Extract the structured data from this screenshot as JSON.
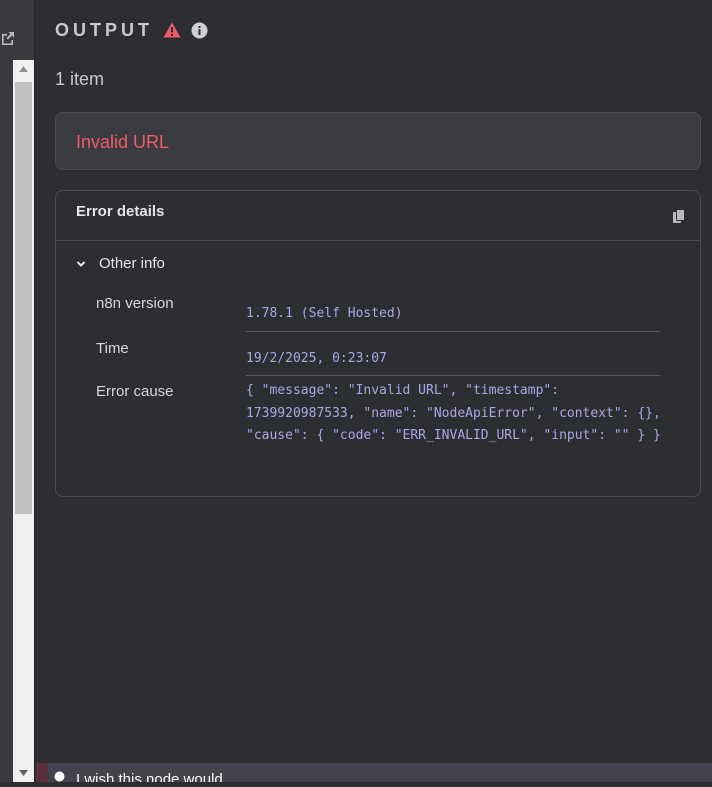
{
  "panel": {
    "title": "OUTPUT",
    "item_count": "1 item"
  },
  "error": {
    "message": "Invalid URL"
  },
  "details": {
    "title": "Error details",
    "section_label": "Other info",
    "rows": [
      {
        "key": "n8n version",
        "value": "1.78.1 (Self Hosted)"
      },
      {
        "key": "Time",
        "value": "19/2/2025, 0:23:07"
      },
      {
        "key": "Error cause",
        "value": "{ \"message\": \"Invalid URL\", \"timestamp\": 1739920987533, \"name\": \"NodeApiError\", \"context\": {}, \"cause\": { \"code\": \"ERR_INVALID_URL\", \"input\": \"\" } }"
      }
    ]
  },
  "feedback": {
    "text": "I wish this node would"
  },
  "icons": {
    "warning": "warning-triangle-icon",
    "info": "info-circle-icon",
    "copy": "copy-icon",
    "chevron": "chevron-down-icon",
    "external": "external-link-icon",
    "feedback": "bulb-icon"
  },
  "colors": {
    "background": "#2d2e32",
    "error": "#ef5a6c",
    "mono_value": "#a8a8e6"
  }
}
